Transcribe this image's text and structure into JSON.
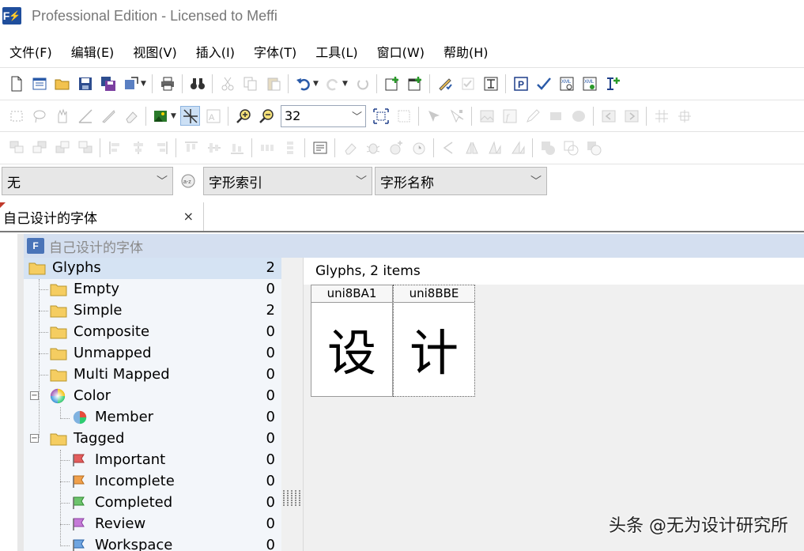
{
  "window": {
    "title": "Professional Edition - Licensed to Meffi"
  },
  "menu": [
    "文件(F)",
    "编辑(E)",
    "视图(V)",
    "插入(I)",
    "字体(T)",
    "工具(L)",
    "窗口(W)",
    "帮助(H)"
  ],
  "toolbar2": {
    "zoom_value": "32"
  },
  "filters": {
    "filter_value": "无",
    "index_value": "字形索引",
    "name_value": "字形名称"
  },
  "tab": {
    "label": "自己设计的字体",
    "close": "×"
  },
  "document": {
    "title": "自己设计的字体"
  },
  "tree": [
    {
      "label": "Glyphs",
      "count": "2"
    },
    {
      "label": "Empty",
      "count": "0"
    },
    {
      "label": "Simple",
      "count": "2"
    },
    {
      "label": "Composite",
      "count": "0"
    },
    {
      "label": "Unmapped",
      "count": "0"
    },
    {
      "label": "Multi Mapped",
      "count": "0"
    },
    {
      "label": "Color",
      "count": "0"
    },
    {
      "label": "Member",
      "count": "0"
    },
    {
      "label": "Tagged",
      "count": "0"
    },
    {
      "label": "Important",
      "count": "0"
    },
    {
      "label": "Incomplete",
      "count": "0"
    },
    {
      "label": "Completed",
      "count": "0"
    },
    {
      "label": "Review",
      "count": "0"
    },
    {
      "label": "Workspace",
      "count": "0"
    }
  ],
  "glyph_panel": {
    "header": "Glyphs, 2 items",
    "glyphs": [
      {
        "name": "uni8BA1",
        "char": "设"
      },
      {
        "name": "uni8BBE",
        "char": "计"
      }
    ]
  },
  "watermark": "头条 @无为设计研究所",
  "colors": {
    "selection": "#d5e3f3",
    "header": "#d4dff0",
    "tree_bg": "#f3f6fa",
    "folder": "#f5cd61"
  }
}
